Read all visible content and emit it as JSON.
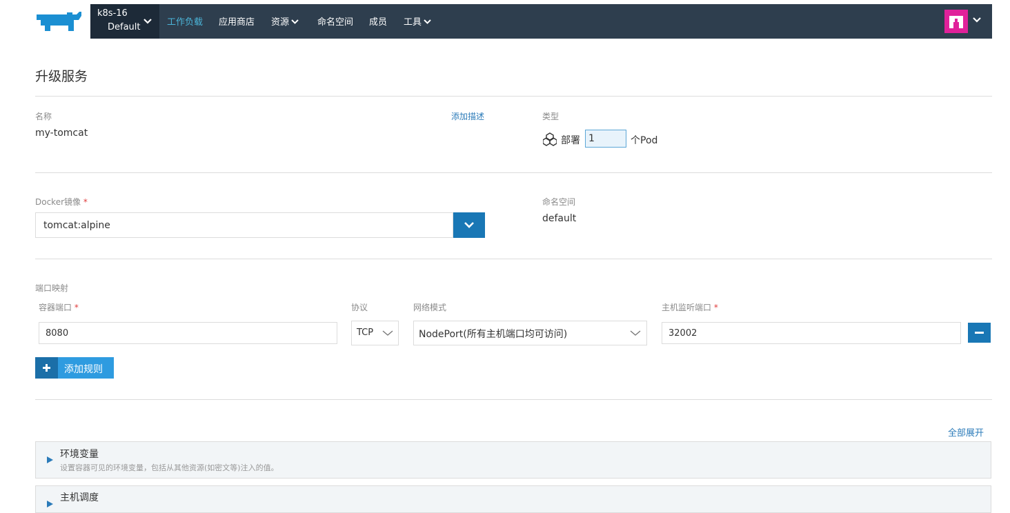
{
  "navbar": {
    "cluster_name": "k8s-16",
    "project_name": "Default",
    "items": [
      {
        "label": "工作负载",
        "active": true,
        "dropdown": false
      },
      {
        "label": "应用商店",
        "active": false,
        "dropdown": false
      },
      {
        "label": "资源",
        "active": false,
        "dropdown": true
      },
      {
        "label": "命名空间",
        "active": false,
        "dropdown": false
      },
      {
        "label": "成员",
        "active": false,
        "dropdown": false
      },
      {
        "label": "工具",
        "active": false,
        "dropdown": true
      }
    ],
    "colors": {
      "bar": "#2e3e4e",
      "cluster_bg": "#1d2a38",
      "active": "#4bb5d9",
      "logo": "#1b8fd2",
      "avatar": "#e0219a"
    }
  },
  "page": {
    "title": "升级服务"
  },
  "service": {
    "name_label": "名称",
    "name_value": "my-tomcat",
    "add_description": "添加描述",
    "type_label": "类型",
    "deploy_label": "部署",
    "replicas": "1",
    "pod_unit": "个Pod"
  },
  "image": {
    "label": "Docker镜像",
    "required_mark": "*",
    "value": "tomcat:alpine"
  },
  "namespace": {
    "label": "命名空间",
    "value": "default"
  },
  "ports": {
    "section_label": "端口映射",
    "container_port_label": "容器端口",
    "protocol_label": "协议",
    "network_mode_label": "网络模式",
    "host_port_label": "主机监听端口",
    "required_mark": "*",
    "rows": [
      {
        "container_port": "8080",
        "protocol": "TCP",
        "network_mode": "NodePort(所有主机端口均可访问)",
        "host_port": "32002"
      }
    ],
    "add_rule_label": "添加规则"
  },
  "sections": {
    "expand_all": "全部展开",
    "items": [
      {
        "title": "环境变量",
        "desc": "设置容器可见的环境变量，包括从其他资源(如密文等)注入的值。"
      },
      {
        "title": "主机调度",
        "desc": ""
      }
    ]
  },
  "colors": {
    "primary": "#1977b5",
    "link": "#2b7bb9",
    "required": "#e03c3c"
  }
}
